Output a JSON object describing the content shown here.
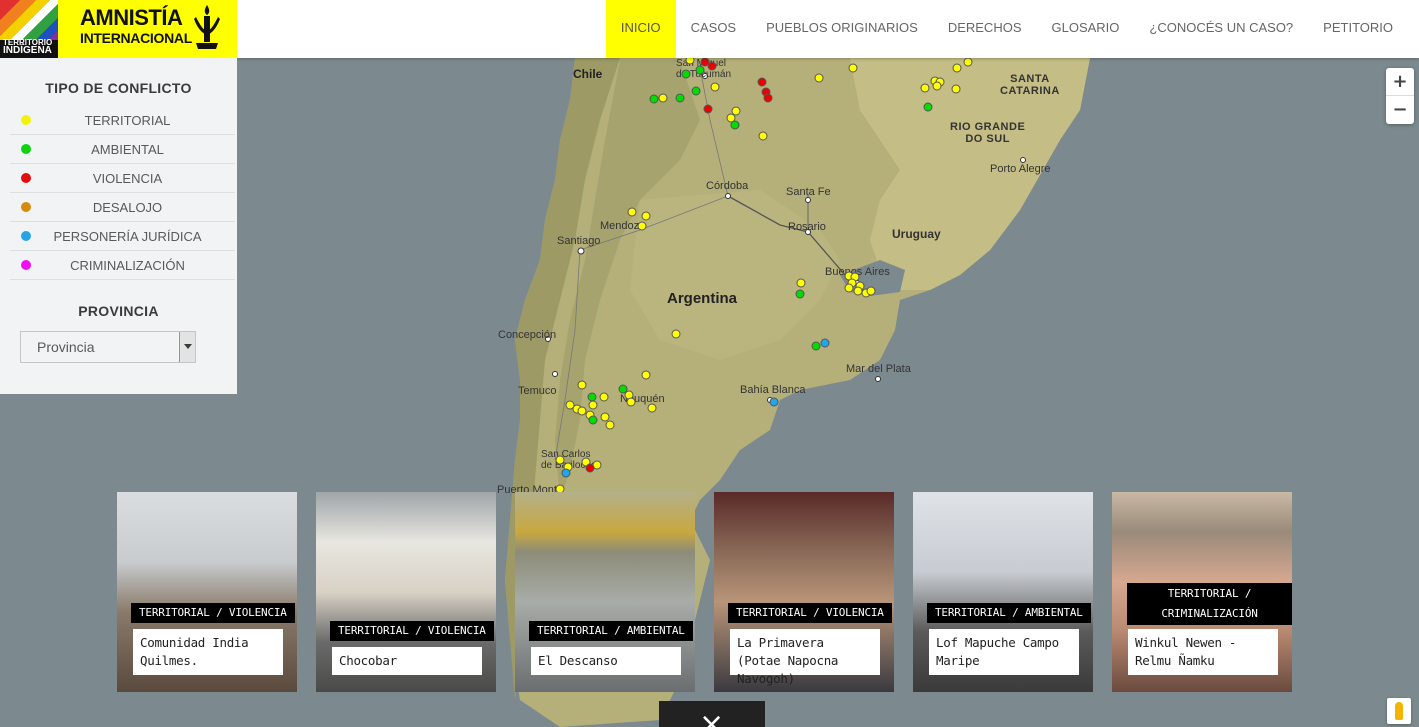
{
  "header": {
    "logo_indigena_text": [
      "TERRITORIO",
      "INDÍGENA"
    ],
    "logo_ai_line1": "AMNISTÍA",
    "logo_ai_line2": "INTERNACIONAL",
    "nav": [
      {
        "label": "INICIO",
        "active": true
      },
      {
        "label": "CASOS",
        "active": false
      },
      {
        "label": "PUEBLOS ORIGINARIOS",
        "active": false
      },
      {
        "label": "DERECHOS",
        "active": false
      },
      {
        "label": "GLOSARIO",
        "active": false
      },
      {
        "label": "¿CONOCÉS UN CASO?",
        "active": false
      },
      {
        "label": "PETITORIO",
        "active": false
      }
    ],
    "accent_color": "#ffff00"
  },
  "sidebar": {
    "conflict_title": "TIPO DE CONFLICTO",
    "conflicts": [
      {
        "label": "TERRITORIAL",
        "color": "#ffff00"
      },
      {
        "label": "AMBIENTAL",
        "color": "#00dd00"
      },
      {
        "label": "VIOLENCIA",
        "color": "#ee0000"
      },
      {
        "label": "DESALOJO",
        "color": "#e08a00"
      },
      {
        "label": "PERSONERÍA JURÍDICA",
        "color": "#1ea7f0"
      },
      {
        "label": "CRIMINALIZACIÓN",
        "color": "#ff00ff"
      }
    ],
    "provincia_title": "PROVINCIA",
    "provincia_value": "Provincia"
  },
  "map": {
    "labels": {
      "chile": "Chile",
      "argentina": "Argentina",
      "uruguay": "Uruguay",
      "santa_catarina": "SANTA\nCATARINA",
      "rio_grande": "RIO GRANDE\nDO SUL",
      "porto_alegre": "Porto Alegre",
      "cordoba": "Córdoba",
      "santa_fe": "Santa Fe",
      "rosario": "Rosario",
      "mendoza": "Mendoza",
      "santiago": "Santiago",
      "buenos_aires": "Buenos Aires",
      "concepcion": "Concepción",
      "mar_del_plata": "Mar del Plata",
      "temuco": "Temuco",
      "neuquen": "Neuquén",
      "bahia_blanca": "Bahía Blanca",
      "san_carlos": "San Carlos\nde Bariloche",
      "puerto_montt": "Puerto Montt",
      "tucuman": "San Miguel\nde Tucumán"
    },
    "zoom_in": "+",
    "zoom_out": "−"
  },
  "cases": [
    {
      "tag": "TERRITORIAL / VIOLENCIA",
      "name": "Comunidad India Quilmes."
    },
    {
      "tag": "TERRITORIAL / VIOLENCIA",
      "name": "Chocobar"
    },
    {
      "tag": "TERRITORIAL / AMBIENTAL",
      "name": "El Descanso"
    },
    {
      "tag": "TERRITORIAL / VIOLENCIA",
      "name": "La Primavera (Potae Napocna Navogoh)"
    },
    {
      "tag": "TERRITORIAL / AMBIENTAL",
      "name": "Lof Mapuche Campo Maripe"
    },
    {
      "tag": "TERRITORIAL / CRIMINALIZACIÓN",
      "name": "Winkul Newen - Relmu Ñamku"
    }
  ],
  "close_icon": "×"
}
